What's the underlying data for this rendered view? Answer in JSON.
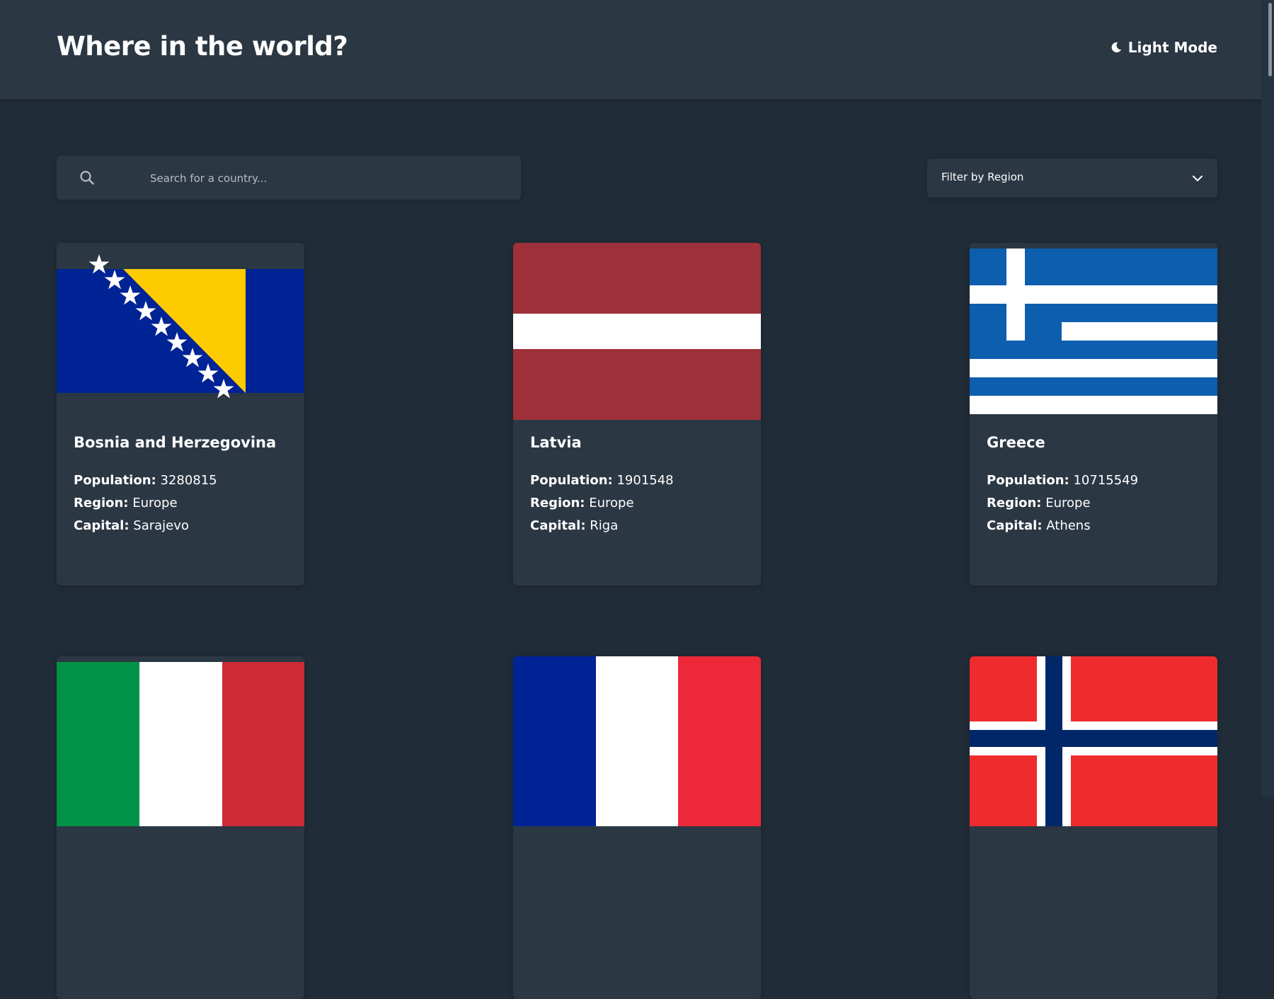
{
  "header": {
    "title": "Where in the world?",
    "mode_toggle": {
      "icon": "moon-icon",
      "label": "Light Mode"
    }
  },
  "search": {
    "icon": "search-icon",
    "placeholder": "Search for a country...",
    "value": ""
  },
  "filter": {
    "label": "Filter by Region",
    "icon": "chevron-down-icon"
  },
  "stat_labels": {
    "population": "Population:",
    "region": "Region:",
    "capital": "Capital:"
  },
  "countries": [
    {
      "name": "Bosnia and Herzegovina",
      "population": "3280815",
      "region": "Europe",
      "capital": "Sarajevo"
    },
    {
      "name": "Latvia",
      "population": "1901548",
      "region": "Europe",
      "capital": "Riga"
    },
    {
      "name": "Greece",
      "population": "10715549",
      "region": "Europe",
      "capital": "Athens"
    },
    {
      "name": "",
      "population": "",
      "region": "",
      "capital": ""
    },
    {
      "name": "",
      "population": "",
      "region": "",
      "capital": ""
    },
    {
      "name": "",
      "population": "",
      "region": "",
      "capital": ""
    }
  ],
  "colors": {
    "background": "#202c37",
    "element": "#2b3743",
    "text": "#ffffff"
  }
}
